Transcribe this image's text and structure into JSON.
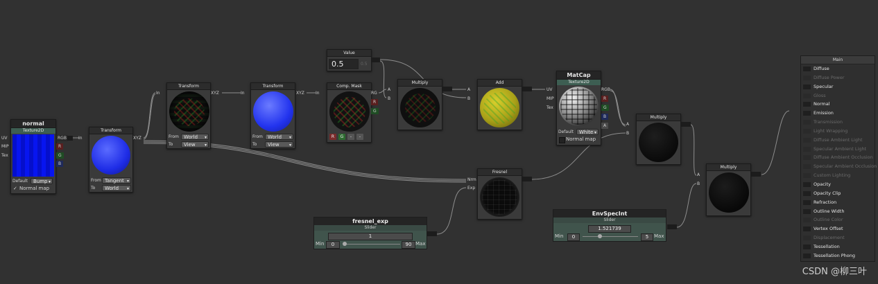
{
  "nodes": {
    "normal": {
      "title": "normal",
      "subtitle": "Texture2D",
      "in": [
        "UV",
        "MIP",
        "Tex"
      ],
      "out": [
        "RGB",
        "R",
        "G",
        "B"
      ],
      "default_label": "Default",
      "default_value": "Bump",
      "check_label": "Normal map",
      "check_mark": "✓"
    },
    "transform1": {
      "title": "Transform",
      "in": "In",
      "out": "XYZ",
      "from_label": "From",
      "from_value": "Tangent",
      "to_label": "To",
      "to_value": "World"
    },
    "transform2": {
      "title": "Transform",
      "in": "In",
      "out": "XYZ",
      "from_label": "From",
      "from_value": "World",
      "to_label": "To",
      "to_value": "View"
    },
    "transform3": {
      "title": "Transform",
      "in": "In",
      "out": "XYZ",
      "from_label": "From",
      "from_value": "World",
      "to_label": "To",
      "to_value": "View"
    },
    "compmask": {
      "title": "Comp. Mask",
      "in": "In",
      "out": [
        "RG",
        "R",
        "G"
      ],
      "buttons": [
        "R",
        "G",
        "-",
        "-"
      ]
    },
    "value": {
      "title": "Value",
      "value": "0.5",
      "aux": "0.5"
    },
    "multiply1": {
      "title": "Multiply",
      "in": [
        "A",
        "B"
      ]
    },
    "add": {
      "title": "Add",
      "in": [
        "A",
        "B"
      ]
    },
    "matcap": {
      "title": "MatCap",
      "subtitle": "Texture2D",
      "in": [
        "UV",
        "MIP",
        "Tex"
      ],
      "out": [
        "RGB",
        "R",
        "G",
        "B",
        "A"
      ],
      "default_label": "Default",
      "default_value": "White",
      "check_label": "Normal map"
    },
    "multiply2": {
      "title": "Multiply",
      "in": [
        "A",
        "B"
      ]
    },
    "multiply3": {
      "title": "Multiply",
      "in": [
        "A",
        "B"
      ]
    },
    "fresnel": {
      "title": "Fresnel",
      "in": [
        "Nrm",
        "Exp"
      ]
    },
    "fresnel_exp": {
      "title": "fresnel_exp",
      "subtitle": "Slider",
      "value": "1",
      "min_label": "Min",
      "min": "0",
      "max": "90",
      "max_label": "Max"
    },
    "envspecint": {
      "title": "EnvSpecInt",
      "subtitle": "Slider",
      "value": "1.521739",
      "min_label": "Min",
      "min": "0",
      "max": "5",
      "max_label": "Max"
    }
  },
  "main_panel": {
    "title": "Main",
    "inputs": [
      {
        "label": "Diffuse",
        "enabled": true
      },
      {
        "label": "Diffuse Power",
        "enabled": false
      },
      {
        "label": "Specular",
        "enabled": true
      },
      {
        "label": "Gloss",
        "enabled": false
      },
      {
        "label": "Normal",
        "enabled": true
      },
      {
        "label": "Emission",
        "enabled": true
      },
      {
        "label": "Transmission",
        "enabled": false
      },
      {
        "label": "Light Wrapping",
        "enabled": false
      },
      {
        "label": "Diffuse Ambient Light",
        "enabled": false
      },
      {
        "label": "Specular Ambient Light",
        "enabled": false
      },
      {
        "label": "Diffuse Ambient Occlusion",
        "enabled": false
      },
      {
        "label": "Specular Ambient Occlusion",
        "enabled": false
      },
      {
        "label": "Custom Lighting",
        "enabled": false
      },
      {
        "label": "Opacity",
        "enabled": true
      },
      {
        "label": "Opacity Clip",
        "enabled": true
      },
      {
        "label": "Refraction",
        "enabled": true
      },
      {
        "label": "Outline Width",
        "enabled": true
      },
      {
        "label": "Outline Color",
        "enabled": false
      },
      {
        "label": "Vertex Offset",
        "enabled": true
      },
      {
        "label": "Displacement",
        "enabled": false
      },
      {
        "label": "Tessellation",
        "enabled": true
      },
      {
        "label": "Tessellation Phong",
        "enabled": true
      }
    ]
  },
  "watermark": "CSDN @柳三叶",
  "colors": {
    "bg": "#313131",
    "node": "#3a3a3a",
    "header": "#2c2c2c",
    "texture_sub": "#3d5e52",
    "slider_node": "#40544c",
    "wire": "#8a8a8a"
  }
}
